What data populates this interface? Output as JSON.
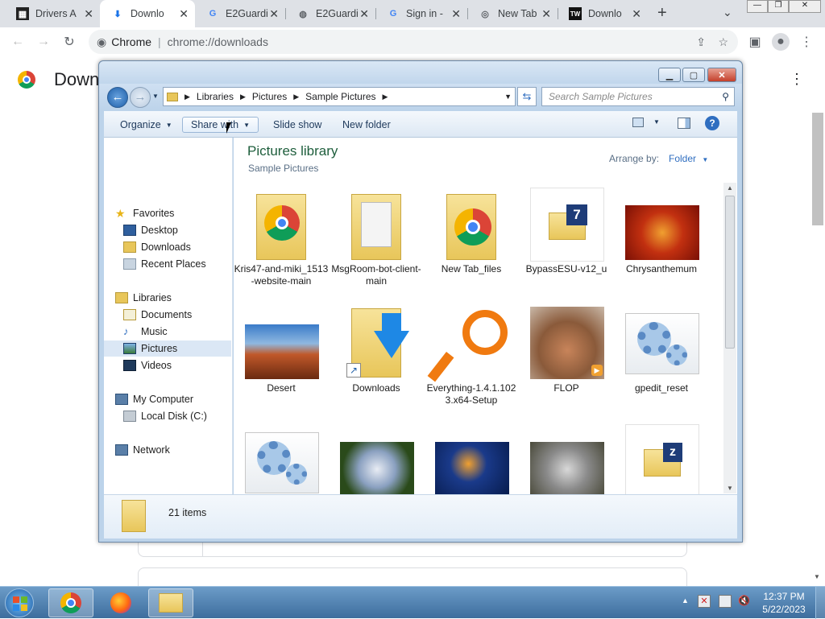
{
  "chrome": {
    "tabs": [
      {
        "label": "Drivers A",
        "icon": "windows-icon"
      },
      {
        "label": "Downlo",
        "icon": "download-icon",
        "active": true
      },
      {
        "label": "E2Guardi",
        "icon": "google-icon"
      },
      {
        "label": "E2Guardi",
        "icon": "globe-icon"
      },
      {
        "label": "Sign in -",
        "icon": "google-icon"
      },
      {
        "label": "New Tab",
        "icon": "chrome-icon"
      },
      {
        "label": "Downlo",
        "icon": "tw-icon"
      }
    ],
    "omnibox": {
      "site_label": "Chrome",
      "url": "chrome://downloads"
    },
    "page_title": "Down"
  },
  "explorer": {
    "breadcrumb": [
      "Libraries",
      "Pictures",
      "Sample Pictures"
    ],
    "search_placeholder": "Search Sample Pictures",
    "commands": {
      "organize": "Organize",
      "share_with": "Share with",
      "slide_show": "Slide show",
      "new_folder": "New folder"
    },
    "nav": {
      "favorites": "Favorites",
      "desktop": "Desktop",
      "downloads": "Downloads",
      "recent_places": "Recent Places",
      "libraries": "Libraries",
      "documents": "Documents",
      "music": "Music",
      "pictures": "Pictures",
      "videos": "Videos",
      "my_computer": "My Computer",
      "local_disk": "Local Disk (C:)",
      "network": "Network"
    },
    "library_title": "Pictures library",
    "library_subtitle": "Sample Pictures",
    "arrange_label": "Arrange by:",
    "arrange_value": "Folder",
    "items": [
      {
        "label": "Kris47-and-miki_1513-website-main",
        "kind": "folder-chrome"
      },
      {
        "label": "MsgRoom-bot-client-main",
        "kind": "folder-docs"
      },
      {
        "label": "New Tab_files",
        "kind": "folder-chrome-single"
      },
      {
        "label": "BypassESU-v12_u",
        "kind": "7z"
      },
      {
        "label": "Chrysanthemum",
        "kind": "photo-chrysanthemum"
      },
      {
        "label": "Desert",
        "kind": "photo-desert"
      },
      {
        "label": "Downloads",
        "kind": "folder-download"
      },
      {
        "label": "Everything-1.4.1.1023.x64-Setup",
        "kind": "everything"
      },
      {
        "label": "FLOP",
        "kind": "photo-flop"
      },
      {
        "label": "gpedit_reset",
        "kind": "gears"
      },
      {
        "label": "",
        "kind": "gears"
      },
      {
        "label": "",
        "kind": "photo-hydrangea"
      },
      {
        "label": "",
        "kind": "photo-jellyfish"
      },
      {
        "label": "",
        "kind": "photo-koala"
      },
      {
        "label": "",
        "kind": "zip"
      }
    ],
    "item_count": "21 items"
  },
  "taskbar": {
    "time": "12:37 PM",
    "date": "5/22/2023"
  }
}
